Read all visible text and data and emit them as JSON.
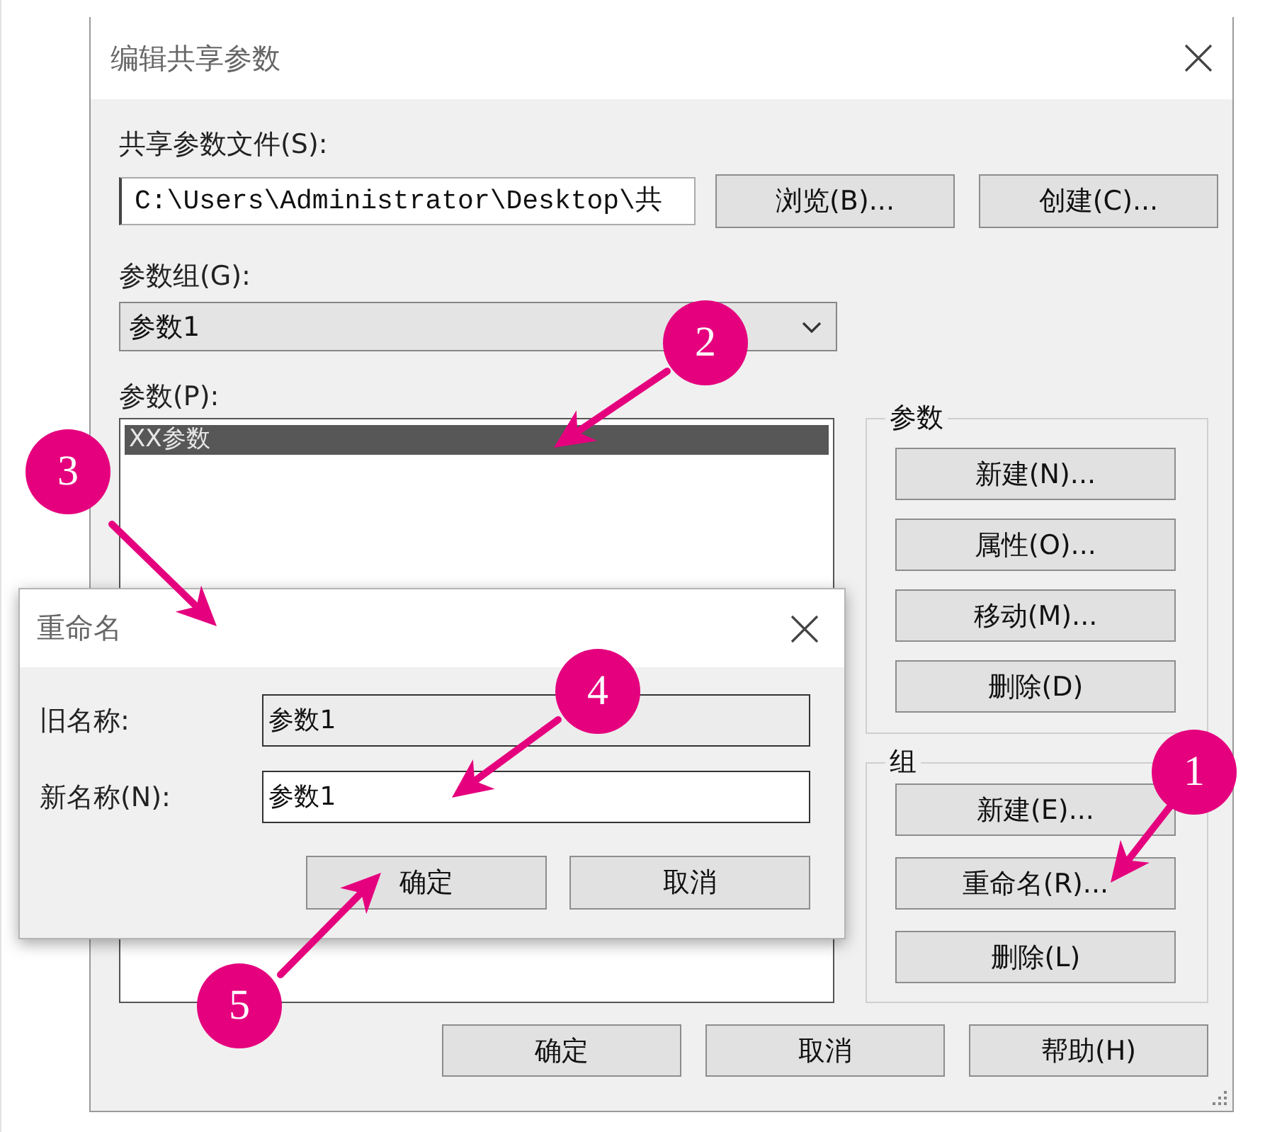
{
  "window": {
    "title": "编辑共享参数"
  },
  "shared_file": {
    "label": "共享参数文件(S):",
    "value": "C:\\Users\\Administrator\\Desktop\\共",
    "buttons": [
      "浏览(B)...",
      "创建(C)..."
    ]
  },
  "parameter_group": {
    "label": "参数组(G):",
    "value": "参数1"
  },
  "parameters": {
    "label": "参数(P):",
    "items": [
      {
        "text": "XX参数",
        "selected": true
      }
    ]
  },
  "parameter_box": {
    "title": "参数",
    "buttons": [
      "新建(N)...",
      "属性(O)...",
      "移动(M)...",
      "删除(D)"
    ]
  },
  "group_box": {
    "title": "组",
    "buttons": [
      "新建(E)...",
      "重命名(R)...",
      "删除(L)"
    ]
  },
  "footer_buttons": [
    "确定",
    "取消",
    "帮助(H)"
  ],
  "rename_dialog": {
    "title": "重命名",
    "fields": [
      {
        "label": "旧名称:",
        "value": "参数1",
        "read_only": true
      },
      {
        "label": "新名称(N):",
        "value": "参数1",
        "read_only": false
      }
    ],
    "buttons": [
      "确定",
      "取消"
    ]
  },
  "callouts": [
    {
      "number": "1"
    },
    {
      "number": "2"
    },
    {
      "number": "3"
    },
    {
      "number": "4"
    },
    {
      "number": "5"
    }
  ]
}
